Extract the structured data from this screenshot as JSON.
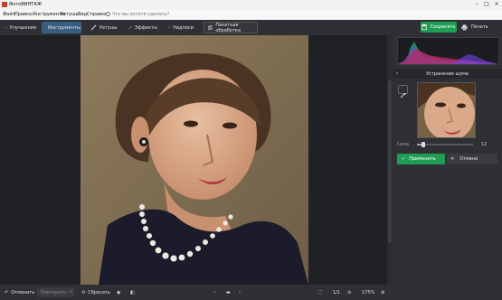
{
  "app": {
    "title": "ФотоВИНТАЖ"
  },
  "menu": {
    "items": [
      "Файл",
      "Правка",
      "Инструменты",
      "Ретушь",
      "Вид",
      "Справка"
    ],
    "search_placeholder": "Что вы хотите сделать?"
  },
  "toolbar": {
    "tabs": [
      {
        "label": "Улучшения",
        "icon": "sliders-icon"
      },
      {
        "label": "Инструменты",
        "icon": "crop-icon",
        "active": true
      },
      {
        "label": "Ретушь",
        "icon": "brush-icon"
      },
      {
        "label": "Эффекты",
        "icon": "magic-wand-icon"
      },
      {
        "label": "Надписи",
        "icon": "text-icon"
      }
    ],
    "batch_label": "Пакетная обработка",
    "save_label": "Сохранить",
    "print_label": "Печать"
  },
  "panel": {
    "title": "Устранение шума",
    "strength_label": "Сила",
    "strength_value": "12",
    "strength_fraction": 0.12,
    "apply_label": "Применить",
    "cancel_label": "Отмена"
  },
  "statusbar": {
    "undo_label": "Отменить",
    "redo_label": "Повторить",
    "reset_label": "Сбросить",
    "page": "1/1",
    "zoom": "175%"
  },
  "colors": {
    "accent_green": "#1f9d55",
    "active_tab": "#3a5d82"
  }
}
